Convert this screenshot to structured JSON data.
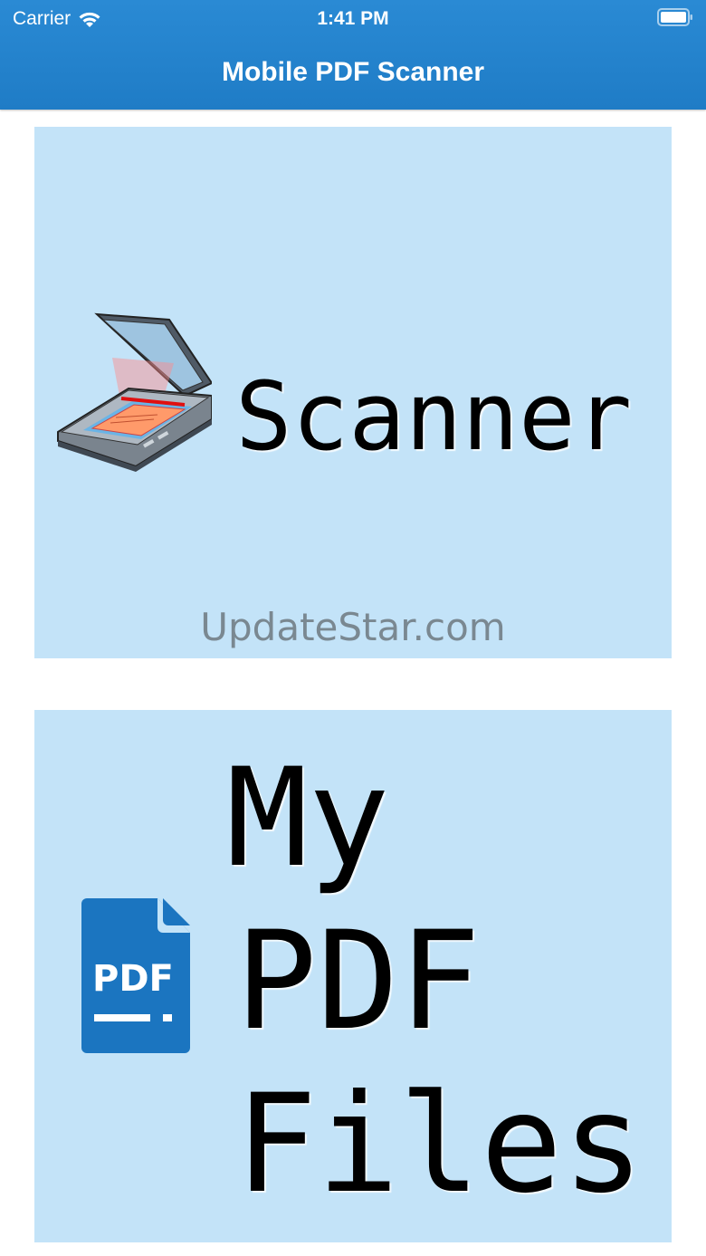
{
  "status_bar": {
    "carrier": "Carrier",
    "time": "1:41 PM",
    "icons": [
      "wifi-icon",
      "battery-icon"
    ]
  },
  "nav": {
    "title": "Mobile PDF Scanner"
  },
  "tiles": {
    "scanner": {
      "label": "Scanner",
      "icon": "scanner-icon"
    },
    "files": {
      "line1": "My",
      "line2": "PDF",
      "line3": "Files",
      "icon": "pdf-file-icon"
    }
  },
  "watermark": "UpdateStar.com",
  "colors": {
    "nav_background": "#1f7cc6",
    "tile_background": "#c3e3f8",
    "pdf_icon_blue": "#1b75c0"
  }
}
